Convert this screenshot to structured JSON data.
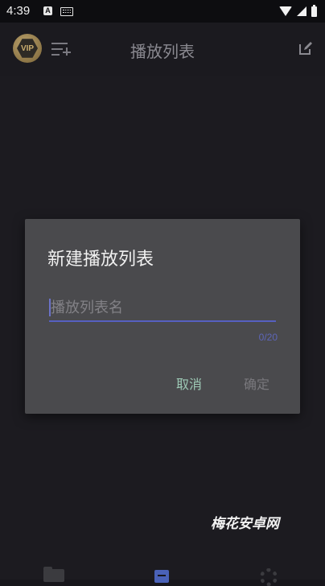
{
  "status_bar": {
    "time": "4:39",
    "notification_a": "A",
    "icons": [
      "a-notification-icon",
      "keyboard-icon",
      "wifi-icon",
      "signal-icon",
      "battery-icon"
    ]
  },
  "app_bar": {
    "vip_label": "VIP",
    "title": "播放列表",
    "icons": [
      "vip-badge-icon",
      "playlist-add-icon",
      "edit-icon"
    ]
  },
  "dialog": {
    "title": "新建播放列表",
    "input": {
      "value": "",
      "placeholder": "播放列表名"
    },
    "counter": "0/20",
    "cancel_label": "取消",
    "ok_label": "确定"
  },
  "watermark": "梅花安卓网",
  "bottom_nav": {
    "icons": [
      "folder-icon",
      "file-icon",
      "settings-gear-icon"
    ]
  },
  "colors": {
    "background": "#17161b",
    "dialog": "#4a4a4d",
    "accent": "#5660c0",
    "cancel": "#9dc9b5"
  }
}
